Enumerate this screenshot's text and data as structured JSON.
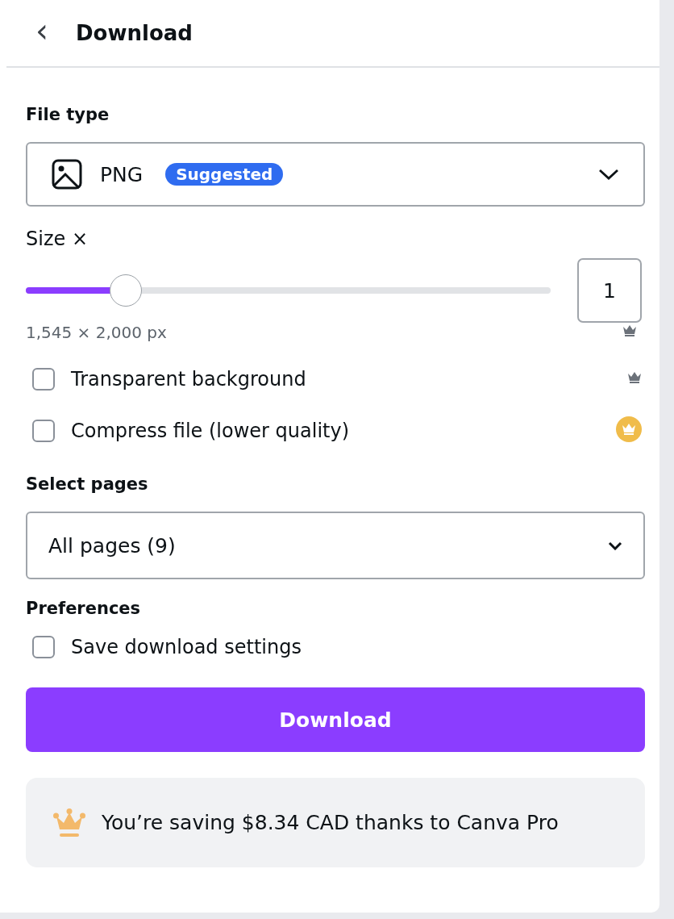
{
  "header": {
    "back": "‹",
    "title": "Download"
  },
  "file_type": {
    "label": "File type",
    "value": "PNG",
    "badge": "Suggested"
  },
  "size": {
    "label": "Size ×",
    "level": 0.19,
    "value": "1",
    "dimensions": "1,545 × 2,000 px",
    "kind": "crown"
  },
  "options": [
    {
      "label": "Transparent background",
      "checked": false,
      "kind": "crown"
    },
    {
      "label": "Compress file (lower quality)",
      "checked": false,
      "kind": "crown-circle"
    }
  ],
  "pages": {
    "label": "Select pages",
    "value": "All pages (9)"
  },
  "preferences": {
    "label": "Preferences",
    "options": [
      {
        "label": "Save download settings",
        "checked": false
      }
    ]
  },
  "download_button": "Download",
  "promo": "You’re saving $8.34 CAD thanks to Canva Pro"
}
